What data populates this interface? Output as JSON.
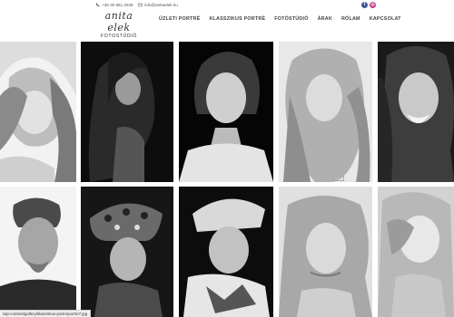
{
  "header": {
    "phone": "+36 30 961 2849",
    "email": "info@anitaelek.hu",
    "logo_script": "anita elek",
    "logo_sub": "FOTOSTÚDIÓ",
    "social": [
      "f",
      "◎"
    ]
  },
  "nav": {
    "items": [
      {
        "label": "ÜZLETI PORTRÉ"
      },
      {
        "label": "KLASSZIKUS PORTRÉ"
      },
      {
        "label": "FOTÓSTÚDIÓ"
      },
      {
        "label": "ÁRAK"
      },
      {
        "label": "RÓLAM"
      },
      {
        "label": "KAPCSOLAT"
      }
    ]
  },
  "gallery": {
    "tiles": [
      {
        "desc": "woman-long-wavy-hair"
      },
      {
        "desc": "woman-dark-hair-dark-background"
      },
      {
        "desc": "woman-hair-up"
      },
      {
        "desc": "woman-curly-blonde-hair"
      },
      {
        "desc": "smiling-woman-curly-hair"
      },
      {
        "desc": "man-short-hair"
      },
      {
        "desc": "woman-patterned-turban"
      },
      {
        "desc": "woman-headscarf"
      },
      {
        "desc": "woman-light-hair-looking-down"
      },
      {
        "desc": "woman-blonde-looking-down"
      }
    ],
    "watermark": "anita"
  },
  "status_url": "/wp-content/gallery/klasszikus-portre/portre7.jpg",
  "colors": {
    "facebook": "#3b5998",
    "instagram": "#c13584"
  }
}
